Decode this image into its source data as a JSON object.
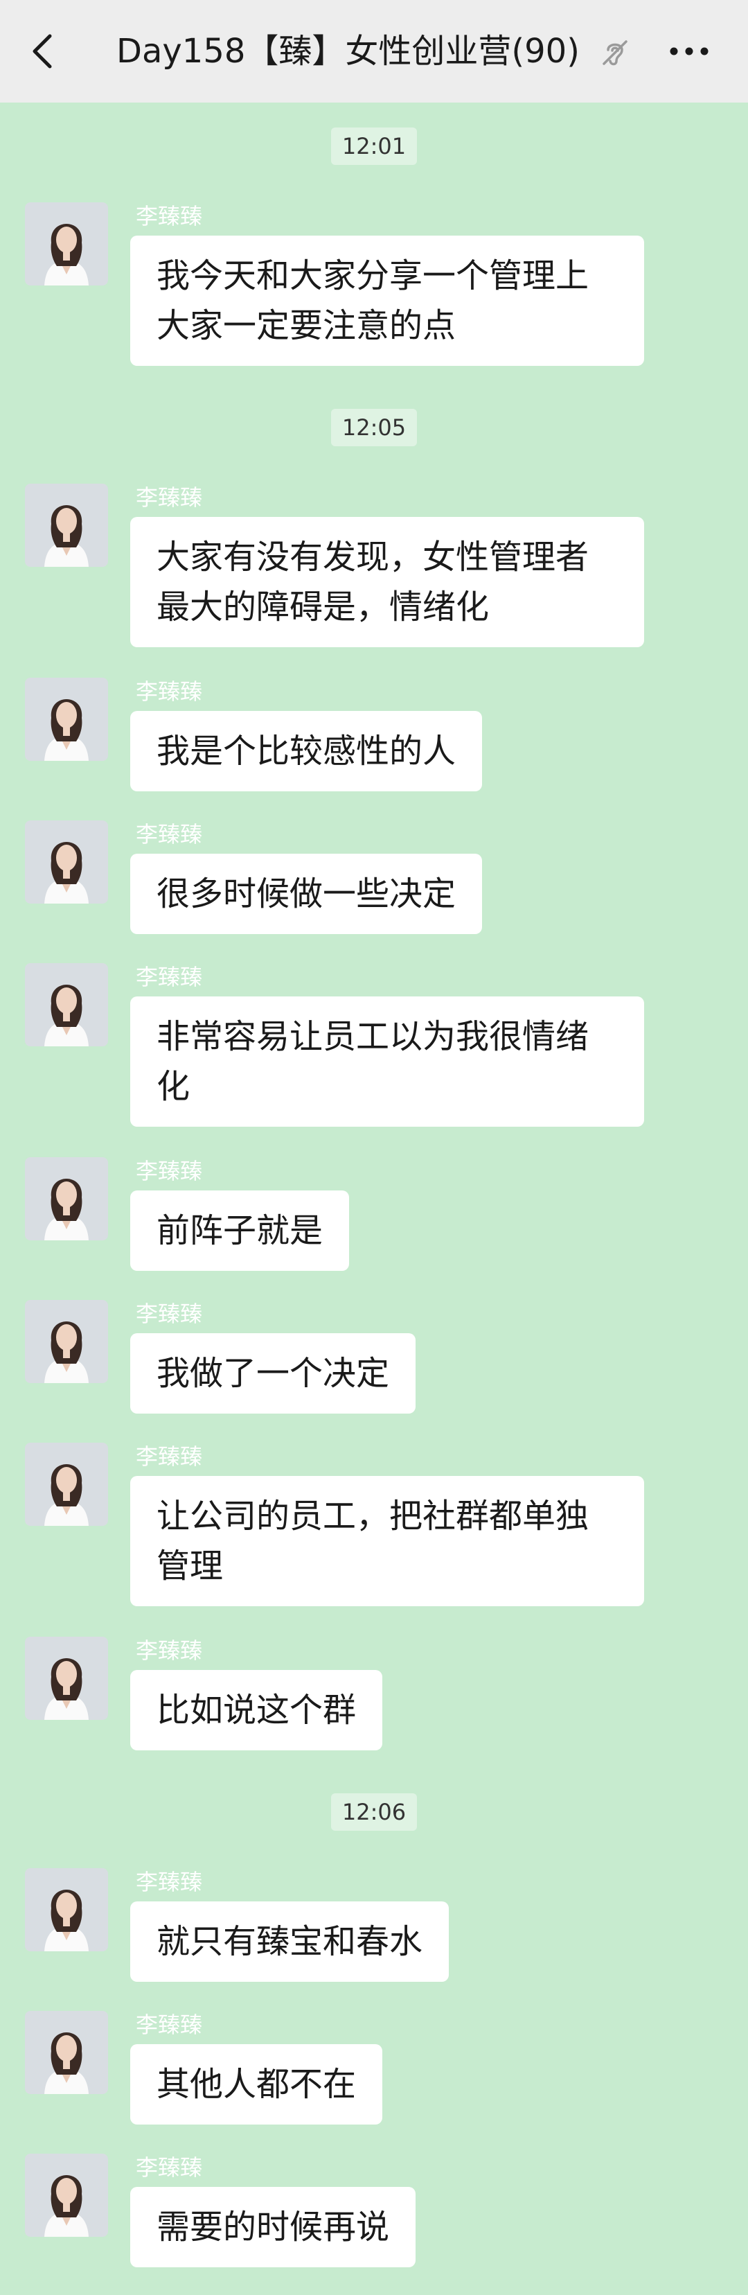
{
  "header": {
    "title": "Day158【臻】女性创业营(90)",
    "back_icon": "chevron-left-icon",
    "mute_icon": "ear-muted-icon",
    "more_icon": "more-dots-icon"
  },
  "colors": {
    "background": "#c7ebcf",
    "header": "#ededed",
    "bubble": "#ffffff",
    "timestamp_bg": "#dff3e3"
  },
  "chat": {
    "timestamps": [
      "12:01",
      "12:05",
      "12:06"
    ],
    "sender_name": "李臻臻",
    "messages": [
      "我今天和大家分享一个管理上大家一定要注意的点",
      "大家有没有发现，女性管理者最大的障碍是，情绪化",
      "我是个比较感性的人",
      "很多时候做一些决定",
      "非常容易让员工以为我很情绪化",
      "前阵子就是",
      "我做了一个决定",
      "让公司的员工，把社群都单独管理",
      "比如说这个群",
      "就只有臻宝和春水",
      "其他人都不在",
      "需要的时候再说"
    ]
  }
}
